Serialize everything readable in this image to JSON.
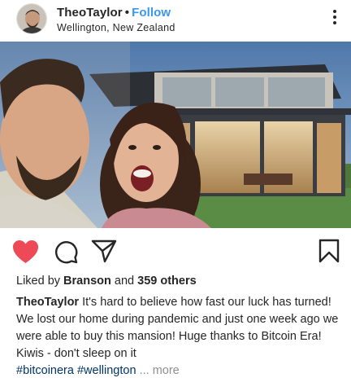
{
  "header": {
    "username": "TheoTaylor",
    "separator": "•",
    "follow_label": "Follow",
    "location": "Wellington, New Zealand"
  },
  "icons": {
    "avatar": "profile-photo",
    "more": "more-options-icon",
    "like": "heart-icon",
    "comment": "comment-icon",
    "share": "share-icon",
    "save": "bookmark-icon"
  },
  "colors": {
    "like_red": "#ed4956",
    "follow_blue": "#3897f0",
    "hashtag_blue": "#003569",
    "muted_gray": "#8e8e8e"
  },
  "likes": {
    "prefix": "Liked by",
    "user": "Branson",
    "connector": "and",
    "others": "359 others"
  },
  "caption": {
    "username": "TheoTaylor",
    "text": "It's hard to believe how fast our luck has turned! We lost our home during pandemic and just one week ago we were able to buy this mansion! Huge thanks to Bitcoin Era! Kiwis - don't sleep on it",
    "hashtag1": "#bitcoinera",
    "hashtag2": "#wellington",
    "ellipsis": "...",
    "more_label": "more"
  }
}
